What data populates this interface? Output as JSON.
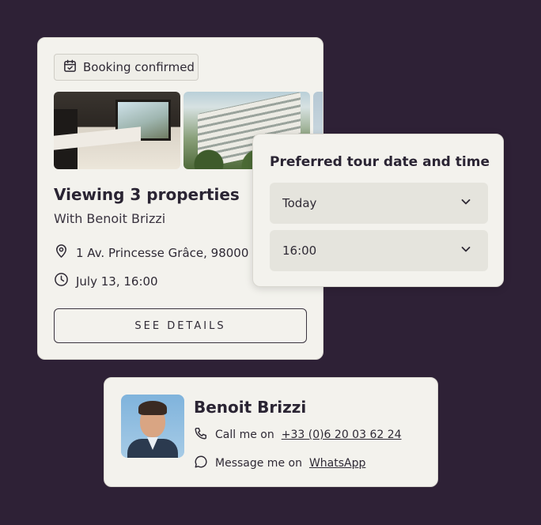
{
  "booking": {
    "badge_label": "Booking confirmed",
    "title": "Viewing 3 properties",
    "subtitle": "With Benoit Brizzi",
    "address": "1 Av. Princesse Grâce, 98000 M",
    "datetime": "July 13, 16:00",
    "details_button": "SEE DETAILS"
  },
  "tour": {
    "title": "Preferred tour date and time",
    "date_value": "Today",
    "time_value": "16:00"
  },
  "agent": {
    "name": "Benoit Brizzi",
    "call_prefix": "Call me on",
    "phone": "+33 (0)6 20 03 62 24",
    "message_prefix": "Message me on",
    "message_app": "WhatsApp"
  },
  "icons": {
    "badge": "calendar-check-icon",
    "address": "map-pin-icon",
    "time": "clock-icon",
    "dropdown": "chevron-down-icon",
    "phone": "phone-icon",
    "message": "chat-bubble-icon"
  },
  "colors": {
    "background": "#2e2136",
    "card": "#f3f2ed",
    "select": "#e5e4dd",
    "text": "#2a2433"
  }
}
